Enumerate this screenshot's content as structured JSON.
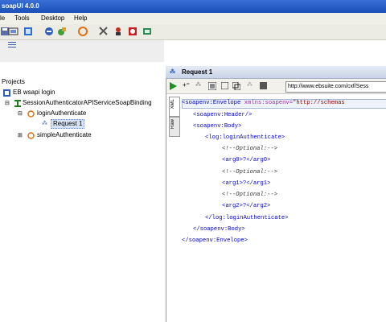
{
  "window": {
    "title": "soapUI 4.0.0"
  },
  "menu": {
    "items": [
      "le",
      "Tools",
      "Desktop",
      "Help"
    ]
  },
  "toolbar": {
    "icons": [
      "save-icon",
      "open-icon",
      "preferences-icon",
      "add-icon",
      "refresh-icon",
      "tools-icon",
      "monitor-icon",
      "stop-icon",
      "extra-icon"
    ]
  },
  "navigator": {
    "root_label": "Projects",
    "project_label": "EB wsapi login",
    "binding_label": "SessionAuthenticatorAPIServiceSoapBinding",
    "operation1_label": "loginAuthenticate",
    "request_label": "Request 1",
    "operation2_label": "simpleAuthenticate"
  },
  "request": {
    "title": "Request 1",
    "endpoint": "http://www.ebsuite.com/cxf/Sess",
    "tabs": [
      "XML",
      "Raw"
    ],
    "xml": {
      "l1_tag": "<soapenv:Envelope ",
      "l1_attr": "xmlns:soapenv=",
      "l1_str": "\"http://schemas",
      "l2": "<soapenv:Header/>",
      "l3": "<soapenv:Body>",
      "l4": "<log:loginAuthenticate>",
      "l5": "<!--Optional:-->",
      "l6": "<arg0>?</arg0>",
      "l7": "<!--Optional:-->",
      "l8": "<arg1>?</arg1>",
      "l9": "<!--Optional:-->",
      "l10": "<arg2>?</arg2>",
      "l11": "</log:loginAuthenticate>",
      "l12": "</soapenv:Body>",
      "l13": "</soapenv:Envelope>"
    }
  },
  "colors": {
    "accent": "#3a6fd8",
    "xml_tag": "#0000cc",
    "xml_attr": "#993399",
    "xml_string": "#8b0000"
  }
}
